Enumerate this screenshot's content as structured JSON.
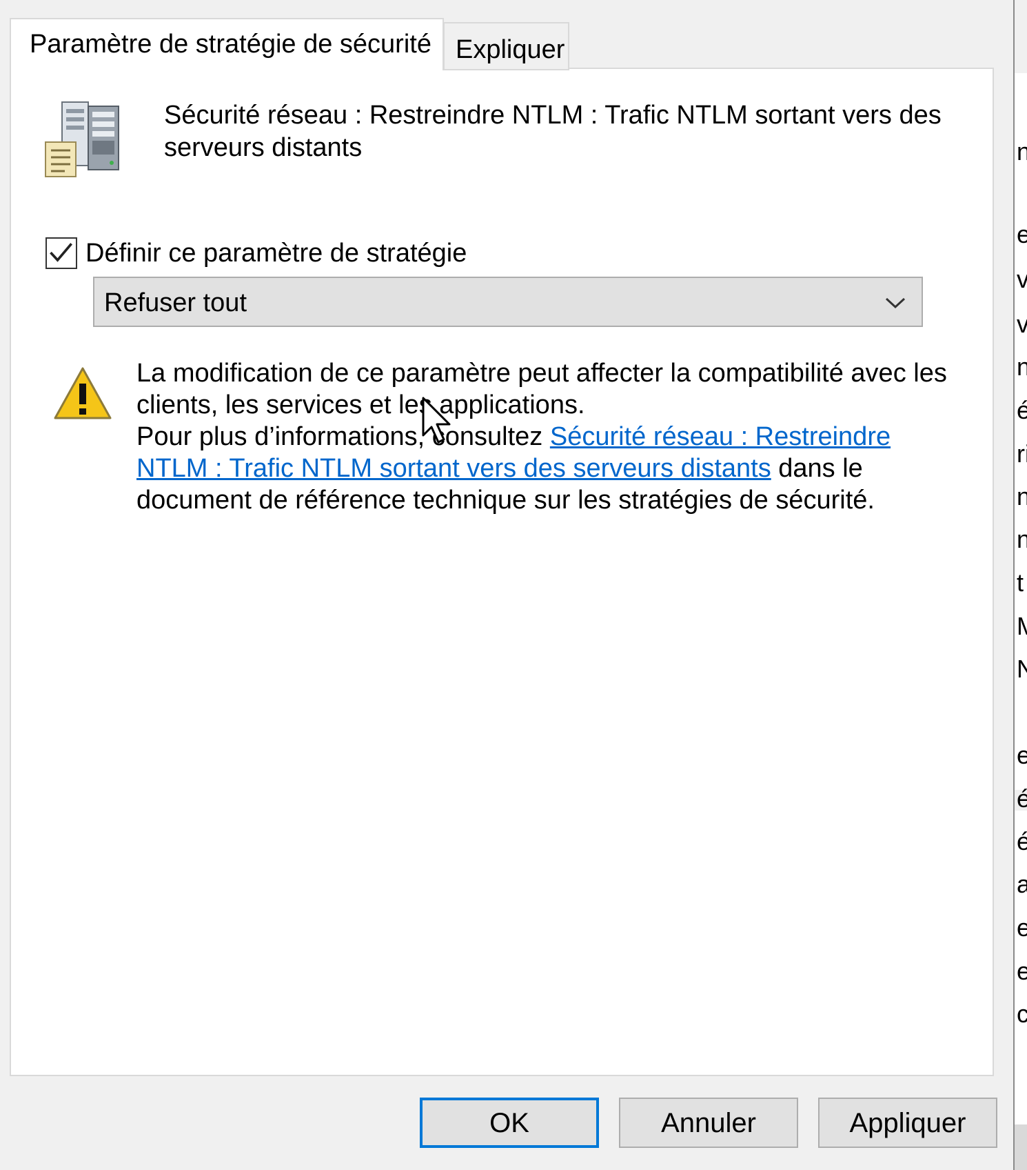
{
  "tabs": {
    "active_label": "Paramètre de stratégie de sécurité",
    "inactive_label": "Expliquer"
  },
  "policy": {
    "title": "Sécurité réseau : Restreindre NTLM : Trafic NTLM sortant vers des serveurs distants",
    "define_label": "Définir ce paramètre de stratégie",
    "define_checked": true,
    "selected_value": "Refuser tout"
  },
  "warning": {
    "line1": "La modification de ce paramètre peut affecter la compatibilité avec les clients, les services et les applications.",
    "line2_prefix": "Pour plus d’informations, consultez ",
    "link_text": "Sécurité réseau : Restreindre NTLM : Trafic NTLM sortant vers des serveurs distants",
    "line2_suffix": " dans le document de référence technique sur les stratégies de sécurité."
  },
  "buttons": {
    "ok": "OK",
    "cancel": "Annuler",
    "apply": "Appliquer"
  },
  "background_window_fragments": [
    {
      "text": "n",
      "row": 1
    },
    {
      "text": "e",
      "row": 2
    },
    {
      "text": "v",
      "row": 3
    },
    {
      "text": "v",
      "row": 4
    },
    {
      "text": "n",
      "row": 5
    },
    {
      "text": "é",
      "row": 6
    },
    {
      "text": "ri",
      "row": 7
    },
    {
      "text": "n",
      "row": 8
    },
    {
      "text": "n",
      "row": 9
    },
    {
      "text": "t",
      "row": 10
    },
    {
      "text": "M",
      "row": 11
    },
    {
      "text": "N",
      "row": 12
    },
    {
      "text": "e",
      "row": 13
    },
    {
      "text": "é",
      "row": 14
    },
    {
      "text": "é",
      "row": 15
    },
    {
      "text": "a",
      "row": 16
    },
    {
      "text": "e",
      "row": 17
    },
    {
      "text": "e",
      "row": 18
    },
    {
      "text": "c",
      "row": 19
    }
  ],
  "colors": {
    "link": "#0066cc",
    "focus_border": "#0078d7",
    "dialog_bg": "#f0f0f0",
    "panel_bg": "#ffffff"
  }
}
